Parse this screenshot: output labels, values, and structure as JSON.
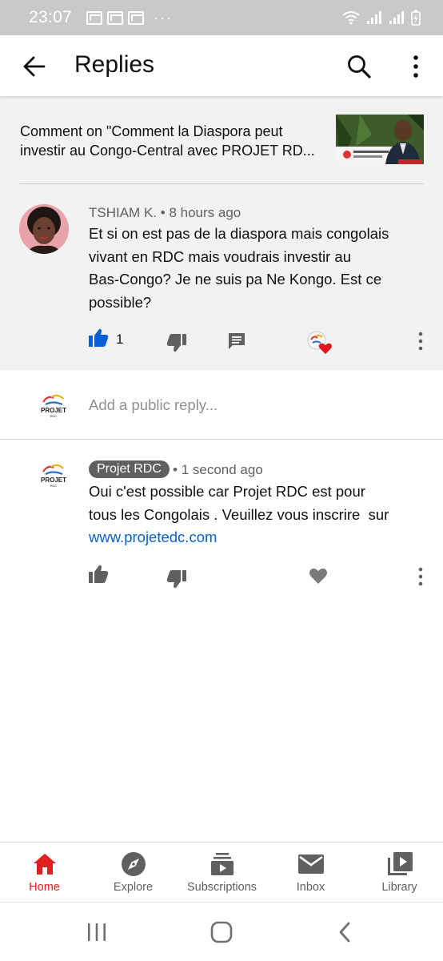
{
  "status_bar": {
    "time": "23:07",
    "dots": "···"
  },
  "app_bar": {
    "title": "Replies"
  },
  "context": {
    "comment_on_line1": "Comment on \"Comment la Diaspora peut",
    "comment_on_line2": "investir au Congo-Central avec PROJET RD..."
  },
  "parent_comment": {
    "author": "TSHIAM K.",
    "time": "8 hours ago",
    "lines": [
      "Et si on est pas de la diaspora mais congolais",
      "vivant en RDC mais voudrais investir au",
      "Bas-Congo? Je ne suis pa Ne Kongo. Est ce",
      "possible?"
    ],
    "like_count": "1"
  },
  "reply_box": {
    "placeholder": "Add a public reply..."
  },
  "reply": {
    "author": "Projet RDC",
    "time": "1 second ago",
    "line1": "Oui c'est possible car Projet RDC est pour",
    "line2": "tous les Congolais . Veuillez vous inscrire  sur",
    "link": "www.projetedc.com"
  },
  "bottom_nav": [
    {
      "label": "Home",
      "icon": "home-icon",
      "active": true
    },
    {
      "label": "Explore",
      "icon": "compass-icon",
      "active": false
    },
    {
      "label": "Subscriptions",
      "icon": "subscriptions-icon",
      "active": false
    },
    {
      "label": "Inbox",
      "icon": "mail-icon",
      "active": false
    },
    {
      "label": "Library",
      "icon": "library-icon",
      "active": false
    }
  ],
  "colors": {
    "accent_red": "#e02020",
    "link_blue": "#065fd4",
    "like_blue": "#065fd4",
    "icon_gray": "#606060"
  }
}
